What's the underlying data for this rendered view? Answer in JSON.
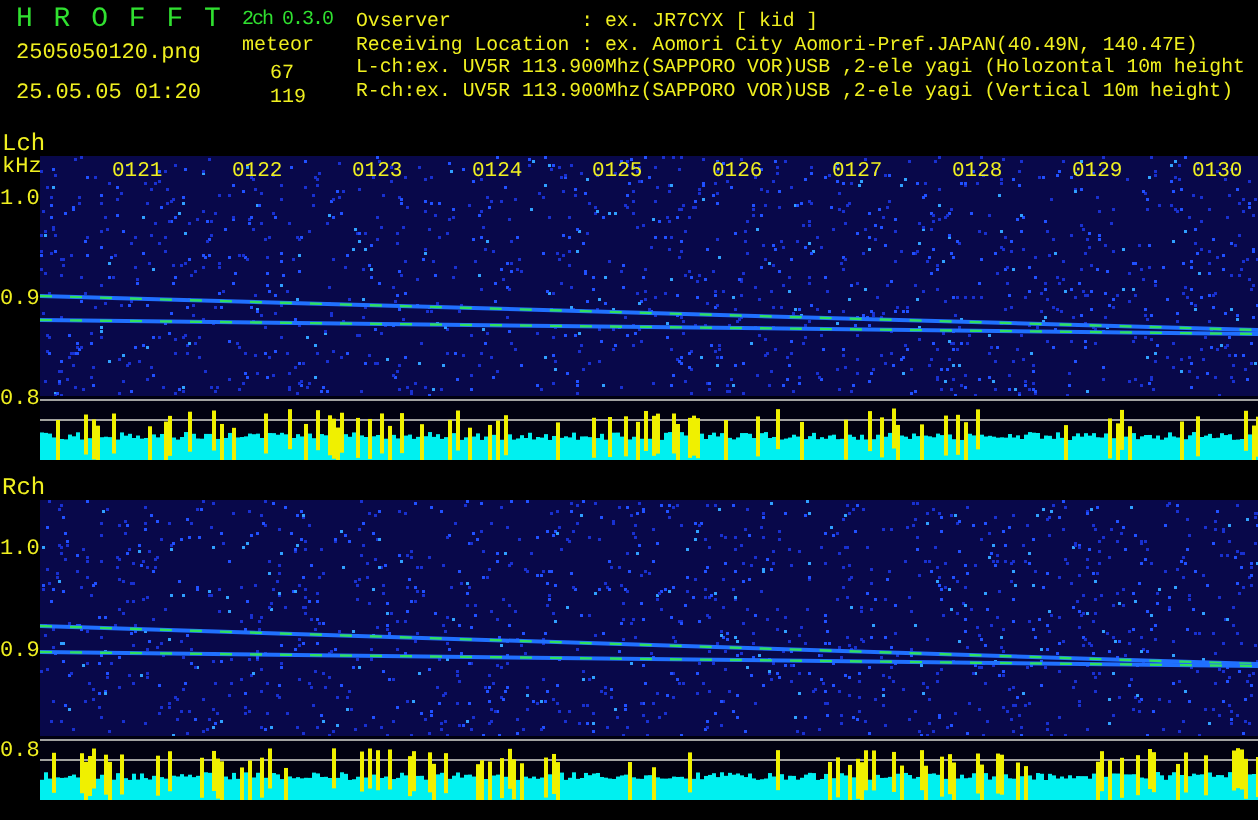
{
  "app": {
    "name": "H R O F F T",
    "version": "2ch 0.3.0",
    "file": "2505050120.png",
    "timestamp": "25.05.05 01:20"
  },
  "meteor": {
    "label": "meteor",
    "counts": [
      "67",
      "119"
    ]
  },
  "info": [
    "Ovserver           : ex. JR7CYX [ kid ]",
    "Receiving Location : ex. Aomori City Aomori-Pref.JAPAN(40.49N, 140.47E)",
    "L-ch:ex. UV5R 113.900Mhz(SAPPORO VOR)USB ,2-ele yagi (Holozontal 10m height",
    "R-ch:ex. UV5R 113.900Mhz(SAPPORO VOR)USB ,2-ele yagi (Vertical 10m height)"
  ],
  "panels": [
    {
      "label": "Lch",
      "unit": "kHz",
      "time_labels": [
        "0121",
        "0122",
        "0123",
        "0124",
        "0125",
        "0126",
        "0127",
        "0128",
        "0129",
        "0130"
      ],
      "y_labels": [
        "1.0",
        "0.9",
        "0.8"
      ]
    },
    {
      "label": "Rch",
      "y_labels": [
        "1.0",
        "0.9",
        "0.8"
      ]
    }
  ]
}
